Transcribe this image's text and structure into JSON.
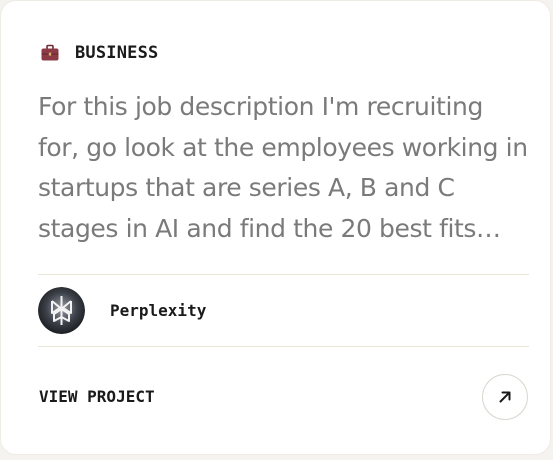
{
  "card": {
    "category": {
      "icon": "briefcase-icon",
      "label": "BUSINESS"
    },
    "description": "For this job description I'm recruiting for, go look at the employees working in startups that are series A, B and C stages in AI and find the 20 best fits…",
    "owner": {
      "avatar_icon": "perplexity-logo-avatar",
      "name": "Perplexity"
    },
    "action": {
      "label": "VIEW PROJECT",
      "icon": "arrow-up-right-icon"
    }
  },
  "colors": {
    "page_background": "#f5f3ef",
    "card_background": "#ffffff",
    "divider": "#e8e4d6",
    "body_text": "#7a7a7a",
    "label_text": "#1a1a1a",
    "briefcase": "#8b3a46"
  }
}
